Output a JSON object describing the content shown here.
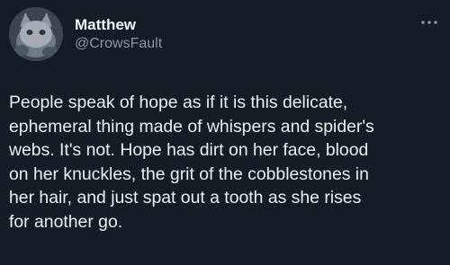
{
  "author": {
    "display_name": "Matthew",
    "handle": "@CrowsFault",
    "avatar_icon": "cat-avatar"
  },
  "menu_icon": "more-dots-icon",
  "tweet": {
    "text": "People speak of hope as if it is this delicate,\nephemeral thing made of whispers and spider's\nwebs. It's not. Hope has dirt on her face, blood\non her knuckles, the grit of the cobblestones in\nher hair, and just spat out a tooth as she rises\nfor another go."
  },
  "colors": {
    "background": "#141d26",
    "text": "#eceeef",
    "secondary": "#8b98a5"
  }
}
